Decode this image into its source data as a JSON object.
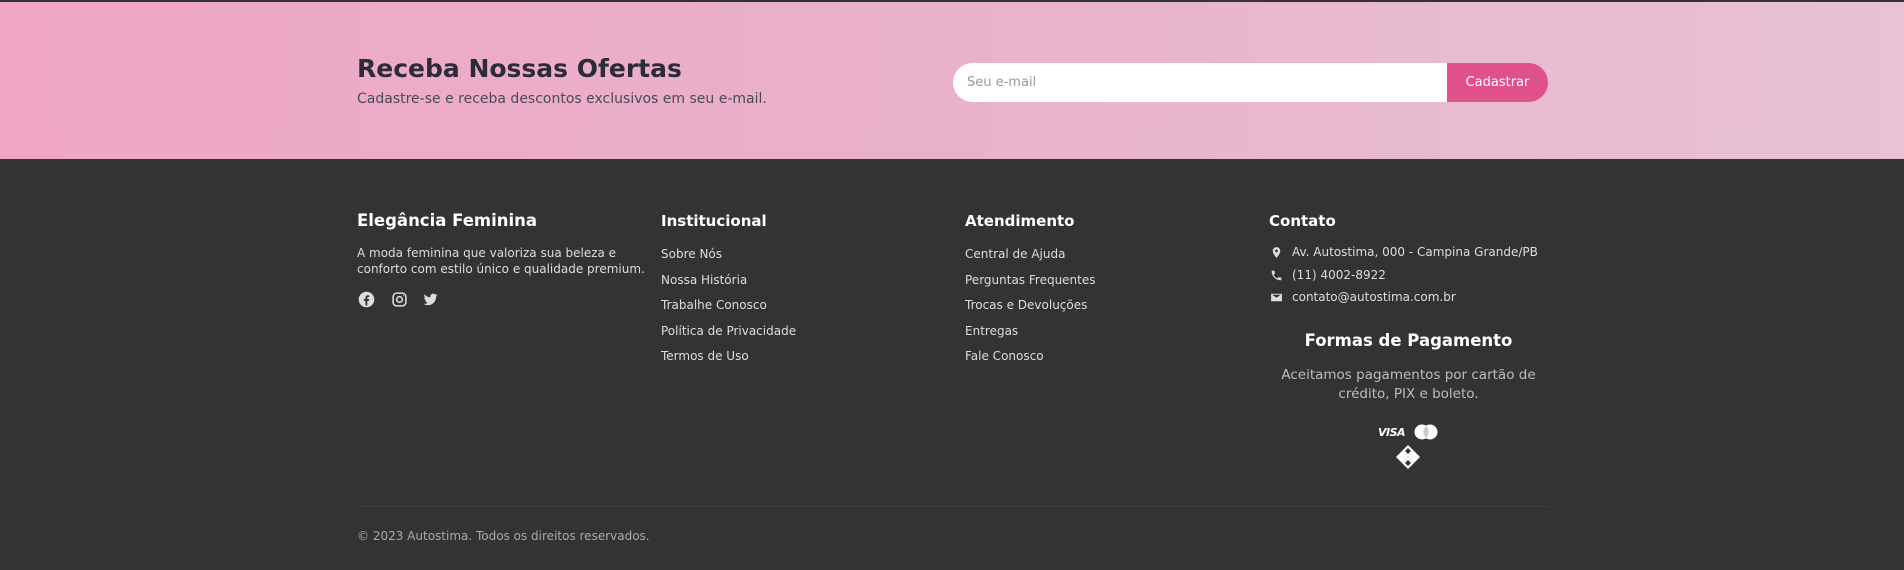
{
  "newsletter": {
    "title": "Receba Nossas Ofertas",
    "subtitle": "Cadastre-se e receba descontos exclusivos em seu e-mail.",
    "email_placeholder": "Seu e-mail",
    "submit_label": "Cadastrar"
  },
  "brand": {
    "title": "Elegância Feminina",
    "description": "A moda feminina que valoriza sua beleza e conforto com estilo único e qualidade premium.",
    "social": [
      "facebook-icon",
      "instagram-icon",
      "twitter-icon"
    ]
  },
  "institutional": {
    "title": "Institucional",
    "links": [
      "Sobre Nós",
      "Nossa História",
      "Trabalhe Conosco",
      "Política de Privacidade",
      "Termos de Uso"
    ]
  },
  "support": {
    "title": "Atendimento",
    "links": [
      "Central de Ajuda",
      "Perguntas Frequentes",
      "Trocas e Devoluções",
      "Entregas",
      "Fale Conosco"
    ]
  },
  "contact": {
    "title": "Contato",
    "address": "Av. Autostima, 000 - Campina Grande/PB",
    "phone": "(11) 4002-8922",
    "email": "contato@autostima.com.br"
  },
  "payment": {
    "title": "Formas de Pagamento",
    "description": "Aceitamos pagamentos por cartão de crédito, PIX e boleto.",
    "visa_label": "VISA",
    "methods": [
      "visa-icon",
      "mastercard-icon",
      "pix-icon"
    ]
  },
  "footer": {
    "copyright": "© 2023 Autostima. Todos os direitos reservados."
  },
  "colors": {
    "newsletter_gradient_start": "#efa6c3",
    "newsletter_gradient_end": "#e7c3d3",
    "accent": "#e0508b",
    "footer_bg": "#333333"
  }
}
